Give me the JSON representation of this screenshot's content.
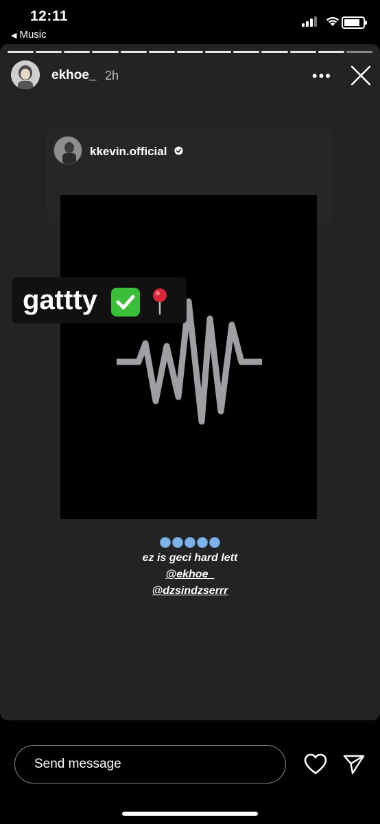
{
  "status_bar": {
    "time": "12:11",
    "back_app": "Music",
    "icons": [
      "cellular-signal-icon",
      "wifi-icon",
      "battery-icon"
    ]
  },
  "story": {
    "username": "ekhoe_",
    "posted_ago": "2h",
    "segments_total": 13,
    "segments_viewed": 12,
    "shared_post": {
      "username": "kkevin.official",
      "verified": true
    },
    "sticker": {
      "text": "gattty"
    },
    "caption": {
      "emoji_count": 5,
      "line": "ez is geci hard lett",
      "mentions": [
        "@ekhoe_",
        "@dzsindzserrr"
      ]
    }
  },
  "footer": {
    "message_placeholder": "Send message"
  },
  "colors": {
    "story_background": "#232323",
    "post_background": "#000000",
    "waveform": "#9e9ea3",
    "check_green": "#3bbf3b"
  }
}
